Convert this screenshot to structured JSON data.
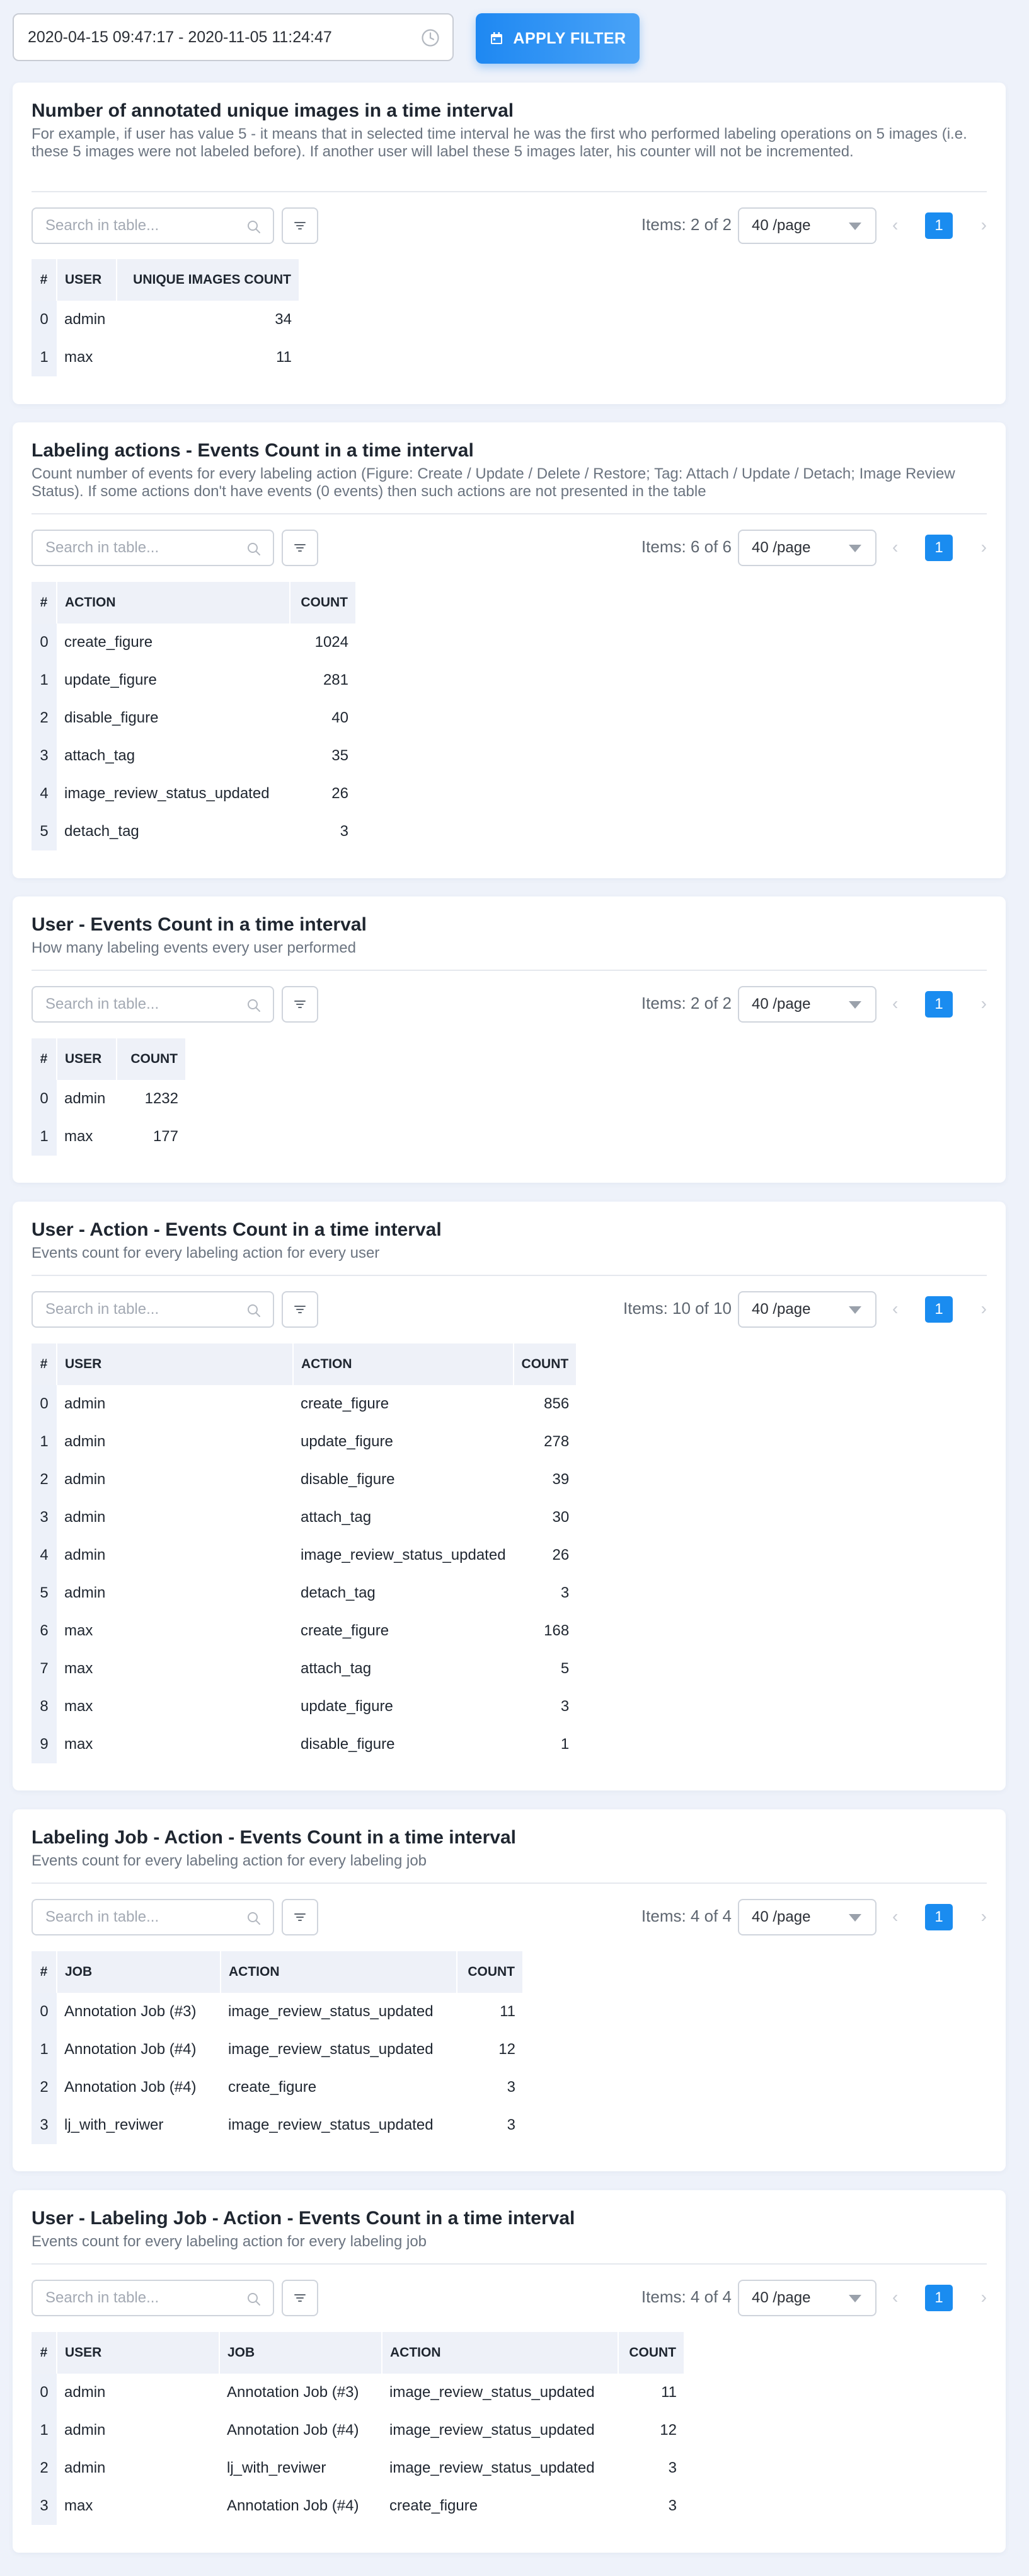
{
  "filter": {
    "date_range": "2020-04-15 09:47:17 - 2020-11-05 11:24:47",
    "apply_label": "APPLY FILTER"
  },
  "common": {
    "search_placeholder": "Search in table...",
    "per_page": "40 /page",
    "current_page": "1"
  },
  "sections": [
    {
      "title": "Number of annotated unique images in a time interval",
      "description": "For example, if user has value 5 - it means that in selected time interval he was the first who performed labeling operations on 5 images (i.e. these 5 images were not labeled before). If another user will label these 5 images later, his counter will not be incremented.",
      "items_info": "Items: 2 of 2",
      "columns": [
        "#",
        "USER",
        "UNIQUE IMAGES COUNT"
      ],
      "rows": [
        [
          "0",
          "admin",
          "34"
        ],
        [
          "1",
          "max",
          "11"
        ]
      ]
    },
    {
      "title": "Labeling actions - Events Count in a time interval",
      "description": "Count number of events for every labeling action (Figure: Create / Update / Delete / Restore; Tag: Attach / Update / Detach; Image Review Status). If some actions don't have events (0 events) then such actions are not presented in the table",
      "items_info": "Items: 6 of 6",
      "columns": [
        "#",
        "ACTION",
        "COUNT"
      ],
      "rows": [
        [
          "0",
          "create_figure",
          "1024"
        ],
        [
          "1",
          "update_figure",
          "281"
        ],
        [
          "2",
          "disable_figure",
          "40"
        ],
        [
          "3",
          "attach_tag",
          "35"
        ],
        [
          "4",
          "image_review_status_updated",
          "26"
        ],
        [
          "5",
          "detach_tag",
          "3"
        ]
      ]
    },
    {
      "title": "User - Events Count in a time interval",
      "description": "How many labeling events every user performed",
      "items_info": "Items: 2 of 2",
      "columns": [
        "#",
        "USER",
        "COUNT"
      ],
      "rows": [
        [
          "0",
          "admin",
          "1232"
        ],
        [
          "1",
          "max",
          "177"
        ]
      ]
    },
    {
      "title": "User - Action - Events Count in a time interval",
      "description": "Events count for every labeling action for every user",
      "items_info": "Items: 10 of 10",
      "columns": [
        "#",
        "USER",
        "ACTION",
        "COUNT"
      ],
      "rows": [
        [
          "0",
          "admin",
          "create_figure",
          "856"
        ],
        [
          "1",
          "admin",
          "update_figure",
          "278"
        ],
        [
          "2",
          "admin",
          "disable_figure",
          "39"
        ],
        [
          "3",
          "admin",
          "attach_tag",
          "30"
        ],
        [
          "4",
          "admin",
          "image_review_status_updated",
          "26"
        ],
        [
          "5",
          "admin",
          "detach_tag",
          "3"
        ],
        [
          "6",
          "max",
          "create_figure",
          "168"
        ],
        [
          "7",
          "max",
          "attach_tag",
          "5"
        ],
        [
          "8",
          "max",
          "update_figure",
          "3"
        ],
        [
          "9",
          "max",
          "disable_figure",
          "1"
        ]
      ]
    },
    {
      "title": "Labeling Job - Action - Events Count in a time interval",
      "description": "Events count for every labeling action for every labeling job",
      "items_info": "Items: 4 of 4",
      "columns": [
        "#",
        "JOB",
        "ACTION",
        "COUNT"
      ],
      "rows": [
        [
          "0",
          "Annotation Job (#3)",
          "image_review_status_updated",
          "11"
        ],
        [
          "1",
          "Annotation Job (#4)",
          "image_review_status_updated",
          "12"
        ],
        [
          "2",
          "Annotation Job (#4)",
          "create_figure",
          "3"
        ],
        [
          "3",
          "lj_with_reviwer",
          "image_review_status_updated",
          "3"
        ]
      ]
    },
    {
      "title": "User - Labeling Job - Action - Events Count in a time interval",
      "description": "Events count for every labeling action for every labeling job",
      "items_info": "Items: 4 of 4",
      "columns": [
        "#",
        "USER",
        "JOB",
        "ACTION",
        "COUNT"
      ],
      "rows": [
        [
          "0",
          "admin",
          "Annotation Job (#3)",
          "image_review_status_updated",
          "11"
        ],
        [
          "1",
          "admin",
          "Annotation Job (#4)",
          "image_review_status_updated",
          "12"
        ],
        [
          "2",
          "admin",
          "lj_with_reviwer",
          "image_review_status_updated",
          "3"
        ],
        [
          "3",
          "max",
          "Annotation Job (#4)",
          "create_figure",
          "3"
        ]
      ]
    }
  ]
}
